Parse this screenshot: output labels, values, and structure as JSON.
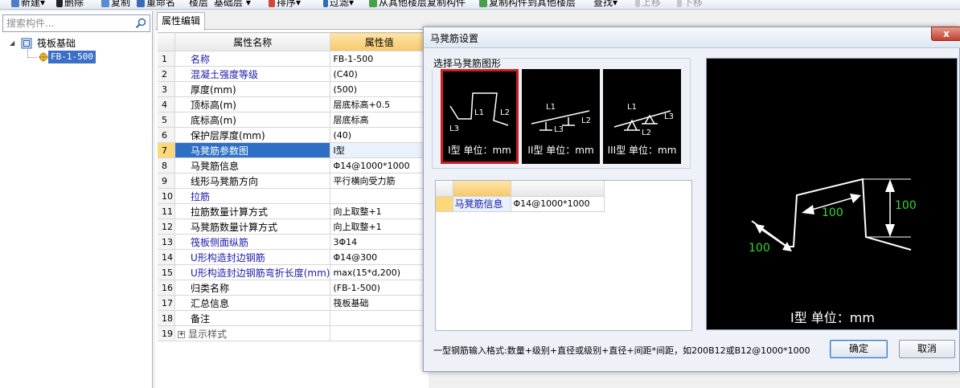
{
  "toolbar": {
    "items": [
      {
        "label": "新建",
        "suffix": "▾"
      },
      {
        "label": "删除"
      },
      {
        "label": "复制"
      },
      {
        "label": "重命名"
      },
      {
        "label": "楼层"
      },
      {
        "label": "基础层",
        "suffix": "▾"
      },
      {
        "label": "排序",
        "suffix": "▾"
      },
      {
        "label": "过滤",
        "suffix": "▾"
      },
      {
        "label": "从其他楼层复制构件"
      },
      {
        "label": "复制构件到其他楼层"
      },
      {
        "label": "查找",
        "suffix": "▾"
      },
      {
        "label": "上移"
      },
      {
        "label": "下移"
      }
    ]
  },
  "left_panel": {
    "search_placeholder": "搜索构件...",
    "tree": {
      "root_label": "筏板基础",
      "toggle": "◢",
      "child_label": "FB-1-500"
    }
  },
  "prop_panel": {
    "tab": "属性编辑",
    "col_name": "属性名称",
    "col_value": "属性值",
    "rows": [
      {
        "n": "1",
        "name": "名称",
        "value": "FB-1-500",
        "blue": true
      },
      {
        "n": "2",
        "name": "混凝土强度等级",
        "value": "(C40)",
        "blue": true
      },
      {
        "n": "3",
        "name": "厚度(mm)",
        "value": "(500)",
        "blue": false
      },
      {
        "n": "4",
        "name": "顶标高(m)",
        "value": "层底标高+0.5",
        "blue": false
      },
      {
        "n": "5",
        "name": "底标高(m)",
        "value": "层底标高",
        "blue": false
      },
      {
        "n": "6",
        "name": "保护层厚度(mm)",
        "value": "(40)",
        "blue": false
      },
      {
        "n": "7",
        "name": "马凳筋参数图",
        "value": "I型",
        "blue": false,
        "selected": true
      },
      {
        "n": "8",
        "name": "马凳筋信息",
        "value": "Φ14@1000*1000",
        "blue": false
      },
      {
        "n": "9",
        "name": "线形马凳筋方向",
        "value": "平行横向受力筋",
        "blue": false
      },
      {
        "n": "10",
        "name": "拉筋",
        "value": "",
        "blue": true
      },
      {
        "n": "11",
        "name": "拉筋数量计算方式",
        "value": "向上取整+1",
        "blue": false
      },
      {
        "n": "12",
        "name": "马凳筋数量计算方式",
        "value": "向上取整+1",
        "blue": false
      },
      {
        "n": "13",
        "name": "筏板侧面纵筋",
        "value": "3Φ14",
        "blue": true
      },
      {
        "n": "14",
        "name": "U形构造封边钢筋",
        "value": "Φ14@300",
        "blue": true
      },
      {
        "n": "15",
        "name": "U形构造封边钢筋弯折长度(mm)",
        "value": "max(15*d,200)",
        "blue": true
      },
      {
        "n": "16",
        "name": "归类名称",
        "value": "(FB-1-500)",
        "blue": false
      },
      {
        "n": "17",
        "name": "汇总信息",
        "value": "筏板基础",
        "blue": false
      },
      {
        "n": "18",
        "name": "备注",
        "value": "",
        "blue": false
      },
      {
        "n": "19",
        "name": "显示样式",
        "value": "",
        "blue": false,
        "expander": "+"
      }
    ]
  },
  "dialog": {
    "title": "马凳筋设置",
    "close": "x",
    "shape_group_label": "选择马凳筋图形",
    "shapes": [
      {
        "caption": "I型 单位：mm",
        "l1": "L1",
        "l2": "L2",
        "l3": "L3",
        "selected": true
      },
      {
        "caption": "II型 单位：mm",
        "l1": "L1",
        "l2": "L2",
        "l3": "L3",
        "selected": false
      },
      {
        "caption": "III型 单位：mm",
        "l1": "L1",
        "l2": "L2",
        "l3": "L3",
        "selected": false
      }
    ],
    "info_label": "马凳筋信息",
    "info_value": "Φ14@1000*1000",
    "preview": {
      "dim_top": "100",
      "dim_mid": "100",
      "dim_left": "100",
      "caption": "I型 单位：mm",
      "green": "#36d536"
    },
    "hint": "一型钢筋输入格式:数量+级别+直径或级别+直径+间距*间距，如200B12或B12@1000*1000",
    "ok": "确定",
    "cancel": "取消"
  }
}
